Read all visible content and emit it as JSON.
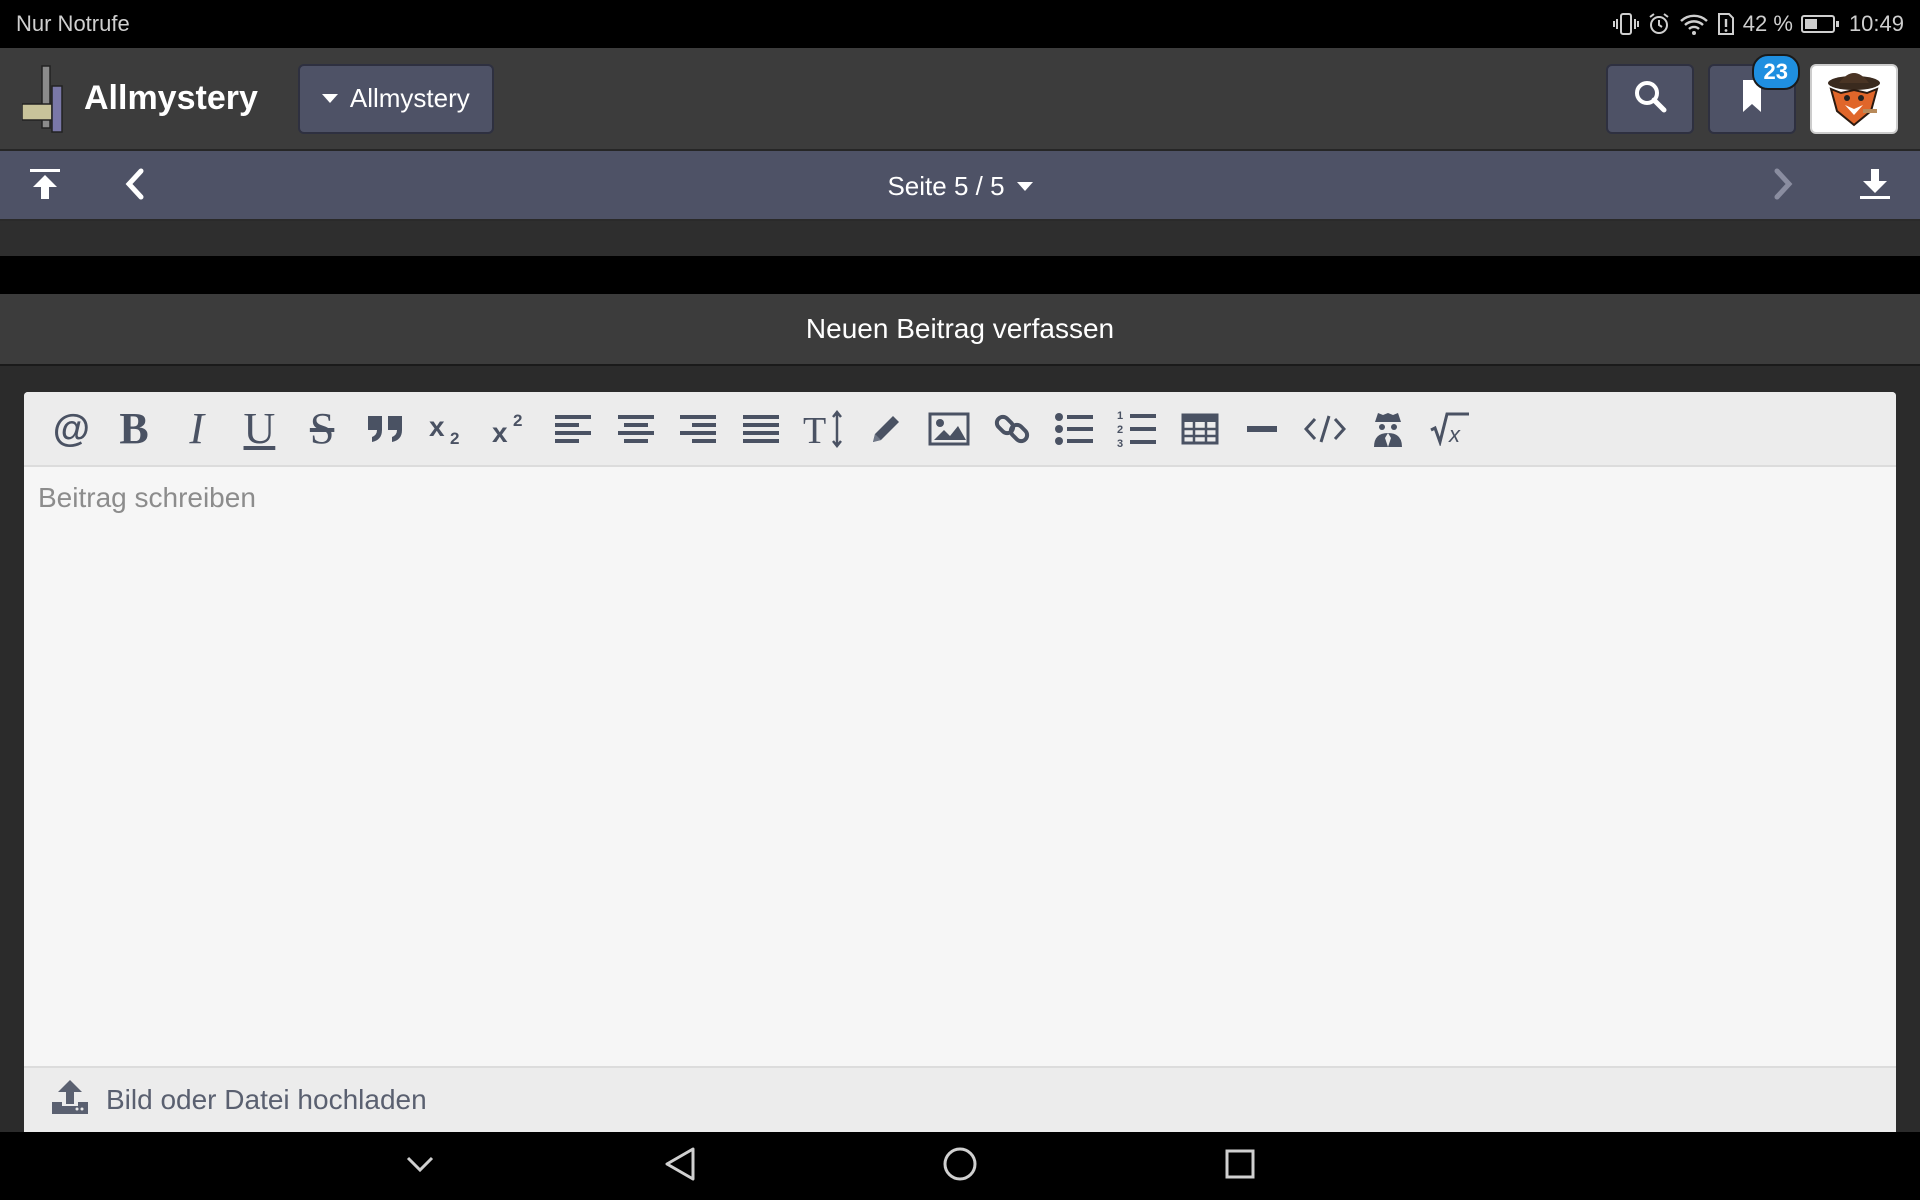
{
  "statusbar": {
    "carrier": "Nur Notrufe",
    "battery_percent": "42 %",
    "battery_level": 0.42,
    "time": "10:49",
    "icons": [
      "vibrate-icon",
      "alarm-icon",
      "wifi-icon",
      "sim-alert-icon",
      "battery-icon"
    ]
  },
  "header": {
    "brand": "Allmystery",
    "forum_selector": "Allmystery",
    "bookmark_count": "23"
  },
  "pagination": {
    "label": "Seite 5 / 5"
  },
  "compose": {
    "title": "Neuen Beitrag verfassen",
    "placeholder": "Beitrag schreiben",
    "upload_label": "Bild oder Datei hochladen",
    "toolbar": [
      "mention",
      "bold",
      "italic",
      "underline",
      "strikethrough",
      "quote",
      "subscript",
      "superscript",
      "align-left",
      "align-center",
      "align-right",
      "justify",
      "font-size",
      "pencil",
      "image",
      "link",
      "bullet-list",
      "numbered-list",
      "table",
      "horizontal-rule",
      "code",
      "spoiler",
      "formula"
    ]
  },
  "colors": {
    "header_bg": "#3c3c3c",
    "accent_bar": "#4e5266",
    "badge": "#1f8fe0",
    "editor_bg": "#f6f6f6",
    "icon": "#4a5263"
  }
}
